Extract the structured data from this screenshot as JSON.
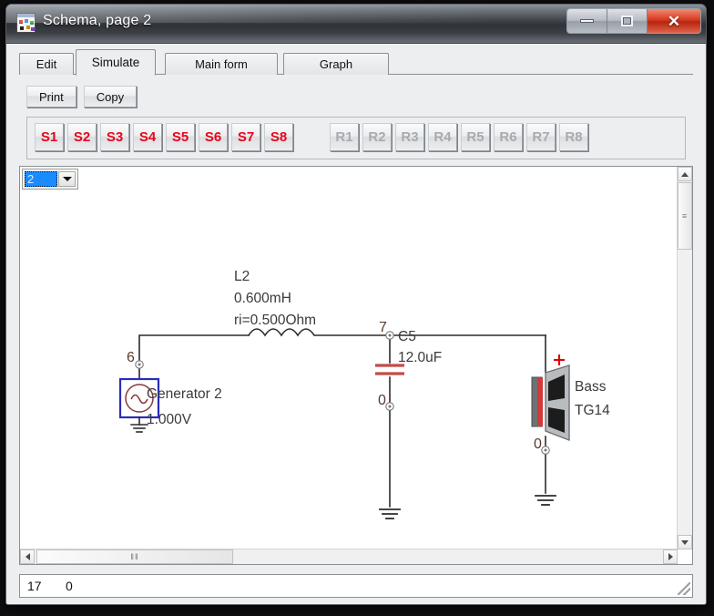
{
  "window": {
    "title": "Schema, page 2",
    "icon": "app-schema-icon",
    "controls": {
      "minimize": "minimize-icon",
      "maximize": "maximize-icon",
      "close": "✕"
    }
  },
  "tabs": [
    {
      "label": "Edit",
      "active": false
    },
    {
      "label": "Simulate",
      "active": true
    },
    {
      "label": "Main form",
      "active": false
    },
    {
      "label": "Graph",
      "active": false
    }
  ],
  "toolbar": {
    "print_label": "Print",
    "copy_label": "Copy"
  },
  "sim_buttons": {
    "s": [
      "S1",
      "S2",
      "S3",
      "S4",
      "S5",
      "S6",
      "S7",
      "S8"
    ],
    "r": [
      "R1",
      "R2",
      "R3",
      "R4",
      "R5",
      "R6",
      "R7",
      "R8"
    ],
    "s_color": "#e8051b",
    "r_color": "#a6abb0"
  },
  "page_selector": {
    "value": "2",
    "arrow": "chevron-down-icon"
  },
  "schematic": {
    "nodes": [
      {
        "id": "6",
        "label": "6"
      },
      {
        "id": "7",
        "label": "7"
      },
      {
        "id": "0a",
        "label": "0"
      },
      {
        "id": "0b",
        "label": "0"
      }
    ],
    "components": [
      {
        "type": "voltage-source",
        "ref": "Generator 2",
        "value": "1.000V",
        "lines": [
          "Generator 2",
          "1.000V"
        ]
      },
      {
        "type": "inductor",
        "ref": "L2",
        "value": "0.600mH",
        "esr": "ri=0.500Ohm",
        "lines": [
          "L2",
          "0.600mH",
          "ri=0.500Ohm"
        ]
      },
      {
        "type": "capacitor",
        "ref": "C5",
        "value": "12.0uF",
        "lines": [
          "C5",
          "12.0uF"
        ]
      },
      {
        "type": "loudspeaker",
        "ref": "Bass",
        "value": "TG14",
        "polarity": "+",
        "lines": [
          "Bass",
          "TG14"
        ]
      }
    ],
    "colors": {
      "wire": "#2b2b2b",
      "text": "#3a3a3a",
      "node_label": "#5a3a2a",
      "capacitor": "#c34a4a",
      "source_box": "#2b2bbb",
      "polarity": "#e00000"
    }
  },
  "scrollbars": {
    "vertical": {
      "up": "scroll-up-icon",
      "down": "scroll-down-icon",
      "grip": "≡"
    },
    "horizontal": {
      "left": "scroll-left-icon",
      "right": "scroll-right-icon",
      "grip": "‖‖"
    }
  },
  "statusbar": {
    "cells": [
      "17",
      "0"
    ]
  }
}
